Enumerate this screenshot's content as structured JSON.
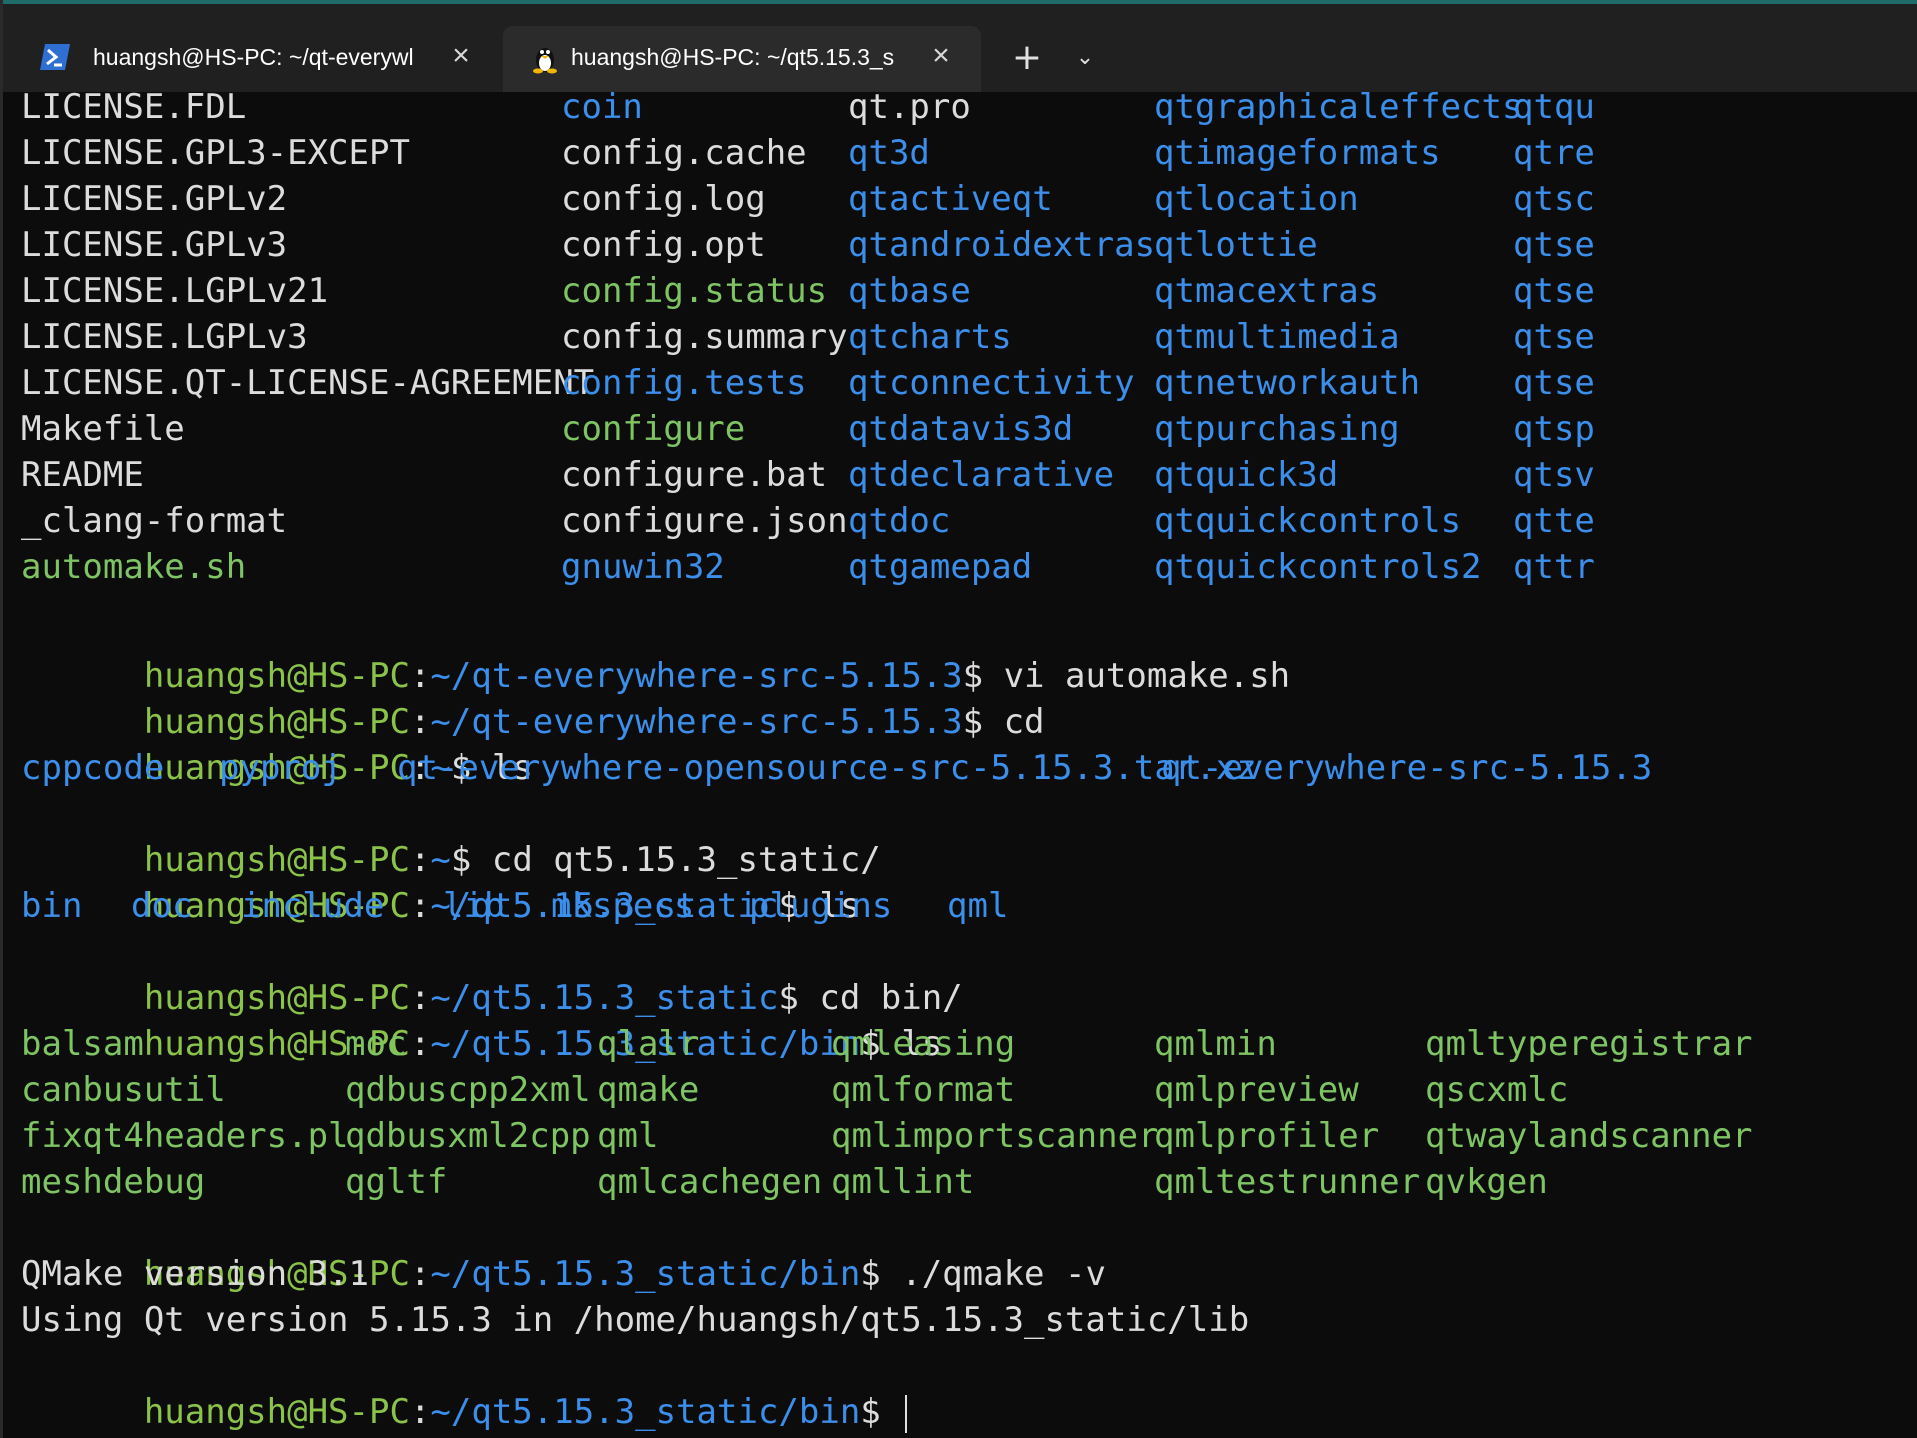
{
  "colors": {
    "prompt_user": "#8bc34a",
    "prompt_path": "#3b8eea",
    "file": "#dcdcdc",
    "directory": "#3b8eea",
    "executable": "#8bc34a",
    "background": "#0c0c0c",
    "tabbar": "#202020"
  },
  "tabs": [
    {
      "title": "huangsh@HS-PC: ~/qt-everywl",
      "icon": "powershell-icon",
      "active": false
    },
    {
      "title": "huangsh@HS-PC: ~/qt5.15.3_s",
      "icon": "linux-tux-icon",
      "active": true
    }
  ],
  "toolbar": {
    "new_tab": "+",
    "dropdown": "⌄"
  },
  "listing1": {
    "col1": [
      "LICENSE.FDL",
      "LICENSE.GPL3-EXCEPT",
      "LICENSE.GPLv2",
      "LICENSE.GPLv3",
      "LICENSE.LGPLv21",
      "LICENSE.LGPLv3",
      "LICENSE.QT-LICENSE-AGREEMENT",
      "Makefile",
      "README",
      "_clang-format",
      "automake.sh"
    ],
    "col2": [
      "coin",
      "config.cache",
      "config.log",
      "config.opt",
      "config.status",
      "config.summary",
      "config.tests",
      "configure",
      "configure.bat",
      "configure.json",
      "gnuwin32"
    ],
    "col3": [
      "qt.pro",
      "qt3d",
      "qtactiveqt",
      "qtandroidextras",
      "qtbase",
      "qtcharts",
      "qtconnectivity",
      "qtdatavis3d",
      "qtdeclarative",
      "qtdoc",
      "qtgamepad"
    ],
    "col4": [
      "qtgraphicaleffects",
      "qtimageformats",
      "qtlocation",
      "qtlottie",
      "qtmacextras",
      "qtmultimedia",
      "qtnetworkauth",
      "qtpurchasing",
      "qtquick3d",
      "qtquickcontrols",
      "qtquickcontrols2"
    ],
    "col5": [
      "qtqu",
      "qtre",
      "qtsc",
      "qtse",
      "qtse",
      "qtse",
      "qtse",
      "qtsp",
      "qtsv",
      "qtte",
      "qttr"
    ]
  },
  "session": {
    "user_host": "huangsh@HS-PC",
    "home_path": "~/qt-everywhere-src-5.15.3",
    "cmd_vi": "$ vi automake.sh",
    "cmd_cd": "$ cd",
    "home": "~",
    "cmd_ls": "$ ls",
    "home_ls": [
      "cppcode",
      "pyproj",
      "qt-everywhere-opensource-src-5.15.3.tar.xz",
      "qt-everywhere-src-5.15.3"
    ],
    "cmd_cd_static": "$ cd qt5.15.3_static/",
    "static_path": "~/qt5.15.3_static",
    "static_ls": [
      "bin",
      "doc",
      "include",
      "lib",
      "mkspecs",
      "plugins",
      "qml"
    ],
    "cmd_cd_bin": "$ cd bin/",
    "bin_path": "~/qt5.15.3_static/bin",
    "cmd_qmake": "$ ./qmake -v",
    "qmake_out1": "QMake version 3.1",
    "qmake_out2": "Using Qt version 5.15.3 in /home/huangsh/qt5.15.3_static/lib",
    "prompt_end": "$ "
  },
  "listing2": {
    "col1": [
      "balsam",
      "canbusutil",
      "fixqt4headers.pl",
      "meshdebug"
    ],
    "col2": [
      "moc",
      "qdbuscpp2xml",
      "qdbusxml2cpp",
      "qgltf"
    ],
    "col3": [
      "qlalr",
      "qmake",
      "qml",
      "qmlcachegen"
    ],
    "col4": [
      "qmleasing",
      "qmlformat",
      "qmlimportscanner",
      "qmllint"
    ],
    "col5": [
      "qmlmin",
      "qmlpreview",
      "qmlprofiler",
      "qmltestrunner"
    ],
    "col6": [
      "qmltyperegistrar",
      "qscxmlc",
      "qtwaylandscanner",
      "qvkgen"
    ]
  }
}
